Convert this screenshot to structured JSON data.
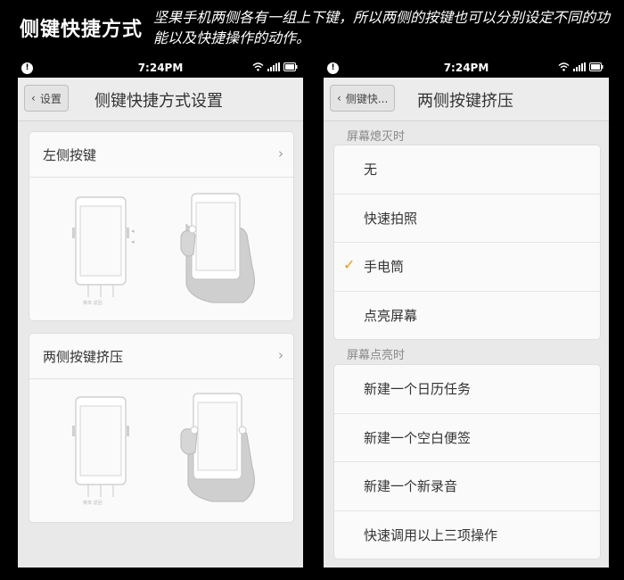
{
  "header": {
    "title": "侧键快捷方式",
    "description": "坚果手机两侧各有一组上下键，所以两侧的按键也可以分别设定不同的功能以及快捷操作的动作。"
  },
  "status_bar": {
    "time": "7:24PM",
    "alert_icon": "!"
  },
  "left_screen": {
    "back_label": "设置",
    "title": "侧键快捷方式设置",
    "cards": [
      {
        "label": "左侧按键",
        "arrow": "›"
      },
      {
        "label": "两侧按键挤压",
        "arrow": "›"
      }
    ],
    "illus_small_text": "菜单 返回"
  },
  "right_screen": {
    "back_label": "侧键快...",
    "title": "两侧按键挤压",
    "section_off": {
      "label": "屏幕熄灭时",
      "items": [
        {
          "label": "无",
          "checked": false
        },
        {
          "label": "快速拍照",
          "checked": false
        },
        {
          "label": "手电筒",
          "checked": true
        },
        {
          "label": "点亮屏幕",
          "checked": false
        }
      ]
    },
    "section_on": {
      "label": "屏幕点亮时",
      "items": [
        {
          "label": "新建一个日历任务"
        },
        {
          "label": "新建一个空白便签"
        },
        {
          "label": "新建一个新录音"
        },
        {
          "label": "快速调用以上三项操作"
        }
      ]
    },
    "check_mark": "✓"
  },
  "colors": {
    "accent_check": "#f39c12",
    "page_bg": "#000000",
    "screen_bg": "#e9e9e9"
  }
}
